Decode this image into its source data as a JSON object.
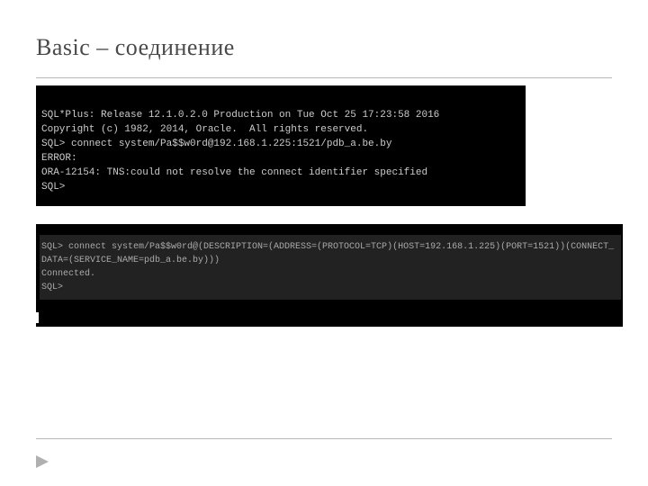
{
  "title": "Basic – соединение",
  "terminal1": {
    "l1": "SQL*Plus: Release 12.1.0.2.0 Production on Tue Oct 25 17:23:58 2016",
    "l2": "",
    "l3": "Copyright (c) 1982, 2014, Oracle.  All rights reserved.",
    "l4": "",
    "l5": "SQL> connect system/Pa$$w0rd@192.168.1.225:1521/pdb_a.be.by",
    "l6": "ERROR:",
    "l7": "ORA-12154: TNS:could not resolve the connect identifier specified",
    "l8": "",
    "l9": "",
    "l10": "SQL>"
  },
  "terminal2": {
    "l1": "SQL> connect system/Pa$$w0rd@(DESCRIPTION=(ADDRESS=(PROTOCOL=TCP)(HOST=192.168.1.225)(PORT=1521))(CONNECT_DATA=(SERVICE_NAME=pdb_a.be.by)))",
    "l2": "Connected.",
    "l3": "SQL>"
  }
}
